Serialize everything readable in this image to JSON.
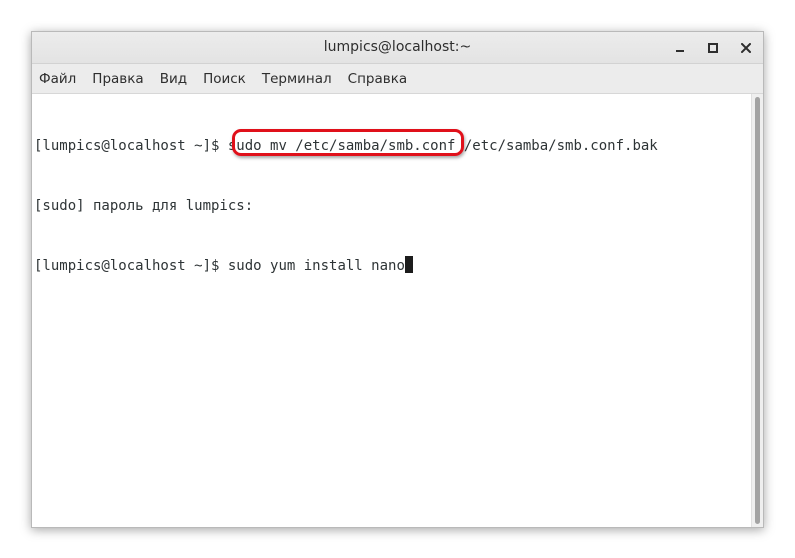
{
  "window": {
    "title": "lumpics@localhost:~"
  },
  "menu": {
    "items": [
      {
        "label": "Файл"
      },
      {
        "label": "Правка"
      },
      {
        "label": "Вид"
      },
      {
        "label": "Поиск"
      },
      {
        "label": "Терминал"
      },
      {
        "label": "Справка"
      }
    ]
  },
  "terminal": {
    "lines": [
      {
        "prompt": "[lumpics@localhost ~]$ ",
        "command": "sudo mv /etc/samba/smb.conf /etc/samba/smb.conf.bak"
      },
      {
        "prompt": "",
        "command": "[sudo] пароль для lumpics:"
      },
      {
        "prompt": "[lumpics@localhost ~]$ ",
        "command": "sudo yum install nano"
      }
    ]
  },
  "colors": {
    "highlight": "#e0101a",
    "terminal_text": "#2e3436",
    "titlebar": "#e6e6e6"
  },
  "icons": {
    "minimize": "minimize-icon",
    "maximize": "maximize-icon",
    "close": "close-icon"
  }
}
